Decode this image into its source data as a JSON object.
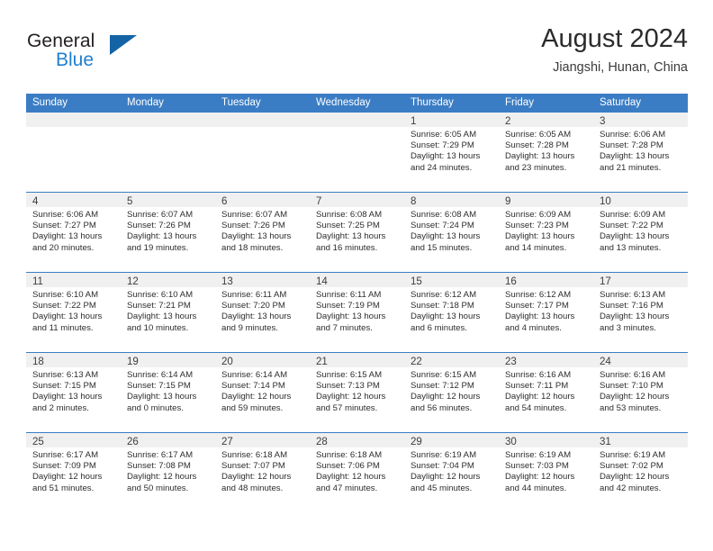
{
  "brand": {
    "name_part1": "General",
    "name_part2": "Blue",
    "triangle_icon": "triangle-logo-icon",
    "accent_color": "#1464a5",
    "blue_color": "#1f7fd0"
  },
  "header": {
    "title": "August 2024",
    "subtitle": "Jiangshi, Hunan, China"
  },
  "calendar": {
    "header_bg_color": "#3b7dc4",
    "day_band_color": "#f0f0f0",
    "weekdays": [
      "Sunday",
      "Monday",
      "Tuesday",
      "Wednesday",
      "Thursday",
      "Friday",
      "Saturday"
    ],
    "weeks": [
      [
        {
          "day": "",
          "sunrise": "",
          "sunset": "",
          "daylight_line1": "",
          "daylight_line2": ""
        },
        {
          "day": "",
          "sunrise": "",
          "sunset": "",
          "daylight_line1": "",
          "daylight_line2": ""
        },
        {
          "day": "",
          "sunrise": "",
          "sunset": "",
          "daylight_line1": "",
          "daylight_line2": ""
        },
        {
          "day": "",
          "sunrise": "",
          "sunset": "",
          "daylight_line1": "",
          "daylight_line2": ""
        },
        {
          "day": "1",
          "sunrise": "Sunrise: 6:05 AM",
          "sunset": "Sunset: 7:29 PM",
          "daylight_line1": "Daylight: 13 hours",
          "daylight_line2": "and 24 minutes."
        },
        {
          "day": "2",
          "sunrise": "Sunrise: 6:05 AM",
          "sunset": "Sunset: 7:28 PM",
          "daylight_line1": "Daylight: 13 hours",
          "daylight_line2": "and 23 minutes."
        },
        {
          "day": "3",
          "sunrise": "Sunrise: 6:06 AM",
          "sunset": "Sunset: 7:28 PM",
          "daylight_line1": "Daylight: 13 hours",
          "daylight_line2": "and 21 minutes."
        }
      ],
      [
        {
          "day": "4",
          "sunrise": "Sunrise: 6:06 AM",
          "sunset": "Sunset: 7:27 PM",
          "daylight_line1": "Daylight: 13 hours",
          "daylight_line2": "and 20 minutes."
        },
        {
          "day": "5",
          "sunrise": "Sunrise: 6:07 AM",
          "sunset": "Sunset: 7:26 PM",
          "daylight_line1": "Daylight: 13 hours",
          "daylight_line2": "and 19 minutes."
        },
        {
          "day": "6",
          "sunrise": "Sunrise: 6:07 AM",
          "sunset": "Sunset: 7:26 PM",
          "daylight_line1": "Daylight: 13 hours",
          "daylight_line2": "and 18 minutes."
        },
        {
          "day": "7",
          "sunrise": "Sunrise: 6:08 AM",
          "sunset": "Sunset: 7:25 PM",
          "daylight_line1": "Daylight: 13 hours",
          "daylight_line2": "and 16 minutes."
        },
        {
          "day": "8",
          "sunrise": "Sunrise: 6:08 AM",
          "sunset": "Sunset: 7:24 PM",
          "daylight_line1": "Daylight: 13 hours",
          "daylight_line2": "and 15 minutes."
        },
        {
          "day": "9",
          "sunrise": "Sunrise: 6:09 AM",
          "sunset": "Sunset: 7:23 PM",
          "daylight_line1": "Daylight: 13 hours",
          "daylight_line2": "and 14 minutes."
        },
        {
          "day": "10",
          "sunrise": "Sunrise: 6:09 AM",
          "sunset": "Sunset: 7:22 PM",
          "daylight_line1": "Daylight: 13 hours",
          "daylight_line2": "and 13 minutes."
        }
      ],
      [
        {
          "day": "11",
          "sunrise": "Sunrise: 6:10 AM",
          "sunset": "Sunset: 7:22 PM",
          "daylight_line1": "Daylight: 13 hours",
          "daylight_line2": "and 11 minutes."
        },
        {
          "day": "12",
          "sunrise": "Sunrise: 6:10 AM",
          "sunset": "Sunset: 7:21 PM",
          "daylight_line1": "Daylight: 13 hours",
          "daylight_line2": "and 10 minutes."
        },
        {
          "day": "13",
          "sunrise": "Sunrise: 6:11 AM",
          "sunset": "Sunset: 7:20 PM",
          "daylight_line1": "Daylight: 13 hours",
          "daylight_line2": "and 9 minutes."
        },
        {
          "day": "14",
          "sunrise": "Sunrise: 6:11 AM",
          "sunset": "Sunset: 7:19 PM",
          "daylight_line1": "Daylight: 13 hours",
          "daylight_line2": "and 7 minutes."
        },
        {
          "day": "15",
          "sunrise": "Sunrise: 6:12 AM",
          "sunset": "Sunset: 7:18 PM",
          "daylight_line1": "Daylight: 13 hours",
          "daylight_line2": "and 6 minutes."
        },
        {
          "day": "16",
          "sunrise": "Sunrise: 6:12 AM",
          "sunset": "Sunset: 7:17 PM",
          "daylight_line1": "Daylight: 13 hours",
          "daylight_line2": "and 4 minutes."
        },
        {
          "day": "17",
          "sunrise": "Sunrise: 6:13 AM",
          "sunset": "Sunset: 7:16 PM",
          "daylight_line1": "Daylight: 13 hours",
          "daylight_line2": "and 3 minutes."
        }
      ],
      [
        {
          "day": "18",
          "sunrise": "Sunrise: 6:13 AM",
          "sunset": "Sunset: 7:15 PM",
          "daylight_line1": "Daylight: 13 hours",
          "daylight_line2": "and 2 minutes."
        },
        {
          "day": "19",
          "sunrise": "Sunrise: 6:14 AM",
          "sunset": "Sunset: 7:15 PM",
          "daylight_line1": "Daylight: 13 hours",
          "daylight_line2": "and 0 minutes."
        },
        {
          "day": "20",
          "sunrise": "Sunrise: 6:14 AM",
          "sunset": "Sunset: 7:14 PM",
          "daylight_line1": "Daylight: 12 hours",
          "daylight_line2": "and 59 minutes."
        },
        {
          "day": "21",
          "sunrise": "Sunrise: 6:15 AM",
          "sunset": "Sunset: 7:13 PM",
          "daylight_line1": "Daylight: 12 hours",
          "daylight_line2": "and 57 minutes."
        },
        {
          "day": "22",
          "sunrise": "Sunrise: 6:15 AM",
          "sunset": "Sunset: 7:12 PM",
          "daylight_line1": "Daylight: 12 hours",
          "daylight_line2": "and 56 minutes."
        },
        {
          "day": "23",
          "sunrise": "Sunrise: 6:16 AM",
          "sunset": "Sunset: 7:11 PM",
          "daylight_line1": "Daylight: 12 hours",
          "daylight_line2": "and 54 minutes."
        },
        {
          "day": "24",
          "sunrise": "Sunrise: 6:16 AM",
          "sunset": "Sunset: 7:10 PM",
          "daylight_line1": "Daylight: 12 hours",
          "daylight_line2": "and 53 minutes."
        }
      ],
      [
        {
          "day": "25",
          "sunrise": "Sunrise: 6:17 AM",
          "sunset": "Sunset: 7:09 PM",
          "daylight_line1": "Daylight: 12 hours",
          "daylight_line2": "and 51 minutes."
        },
        {
          "day": "26",
          "sunrise": "Sunrise: 6:17 AM",
          "sunset": "Sunset: 7:08 PM",
          "daylight_line1": "Daylight: 12 hours",
          "daylight_line2": "and 50 minutes."
        },
        {
          "day": "27",
          "sunrise": "Sunrise: 6:18 AM",
          "sunset": "Sunset: 7:07 PM",
          "daylight_line1": "Daylight: 12 hours",
          "daylight_line2": "and 48 minutes."
        },
        {
          "day": "28",
          "sunrise": "Sunrise: 6:18 AM",
          "sunset": "Sunset: 7:06 PM",
          "daylight_line1": "Daylight: 12 hours",
          "daylight_line2": "and 47 minutes."
        },
        {
          "day": "29",
          "sunrise": "Sunrise: 6:19 AM",
          "sunset": "Sunset: 7:04 PM",
          "daylight_line1": "Daylight: 12 hours",
          "daylight_line2": "and 45 minutes."
        },
        {
          "day": "30",
          "sunrise": "Sunrise: 6:19 AM",
          "sunset": "Sunset: 7:03 PM",
          "daylight_line1": "Daylight: 12 hours",
          "daylight_line2": "and 44 minutes."
        },
        {
          "day": "31",
          "sunrise": "Sunrise: 6:19 AM",
          "sunset": "Sunset: 7:02 PM",
          "daylight_line1": "Daylight: 12 hours",
          "daylight_line2": "and 42 minutes."
        }
      ]
    ]
  }
}
